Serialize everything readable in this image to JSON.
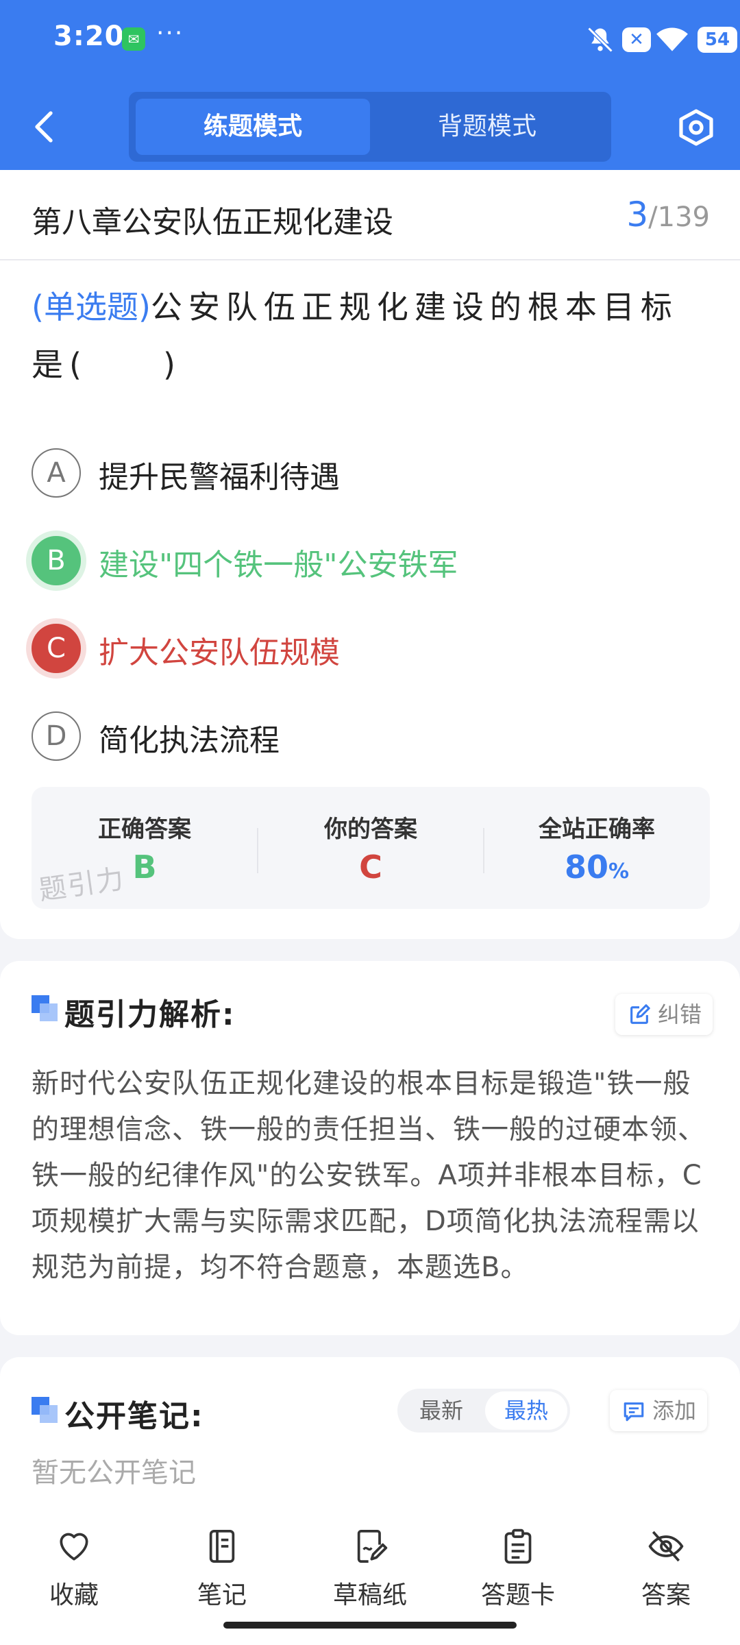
{
  "status_bar": {
    "time": "3:20",
    "dots": "···",
    "battery": "54"
  },
  "header": {
    "tabs": [
      "练题模式",
      "背题模式"
    ],
    "active_tab": 0
  },
  "chapter": {
    "title": "第八章公安队伍正规化建设",
    "current": "3",
    "total": "/139"
  },
  "question": {
    "type_label": "(单选题)",
    "stem": "公安队伍正规化建设的根本目标是(　　)",
    "options": [
      {
        "letter": "A",
        "text": "提升民警福利待遇",
        "state": "normal"
      },
      {
        "letter": "B",
        "text": "建设\"四个铁一般\"公安铁军",
        "state": "correct"
      },
      {
        "letter": "C",
        "text": "扩大公安队伍规模",
        "state": "wrong"
      },
      {
        "letter": "D",
        "text": "简化执法流程",
        "state": "normal"
      }
    ]
  },
  "answer_summary": {
    "correct_label": "正确答案",
    "correct_value": "B",
    "yours_label": "你的答案",
    "yours_value": "C",
    "rate_label": "全站正确率",
    "rate_value": "80",
    "rate_unit": "%",
    "watermark": "题引力"
  },
  "analysis": {
    "title": "题引力解析:",
    "report_label": "纠错",
    "text": "新时代公安队伍正规化建设的根本目标是锻造\"铁一般的理想信念、铁一般的责任担当、铁一般的过硬本领、铁一般的纪律作风\"的公安铁军。A项并非根本目标，C项规模扩大需与实际需求匹配，D项简化执法流程需以规范为前提，均不符合题意，本题选B。"
  },
  "notes": {
    "title": "公开笔记:",
    "sort_options": [
      "最新",
      "最热"
    ],
    "active_sort": 1,
    "add_label": "添加",
    "empty_text": "暂无公开笔记"
  },
  "bottom_tabs": [
    {
      "label": "收藏",
      "icon": "heart-icon"
    },
    {
      "label": "笔记",
      "icon": "notebook-icon"
    },
    {
      "label": "草稿纸",
      "icon": "draft-paper-icon"
    },
    {
      "label": "答题卡",
      "icon": "answer-card-icon"
    },
    {
      "label": "答案",
      "icon": "eye-off-icon"
    }
  ],
  "colors": {
    "primary": "#3a7cf0",
    "correct": "#55c37c",
    "wrong": "#d1453f"
  }
}
